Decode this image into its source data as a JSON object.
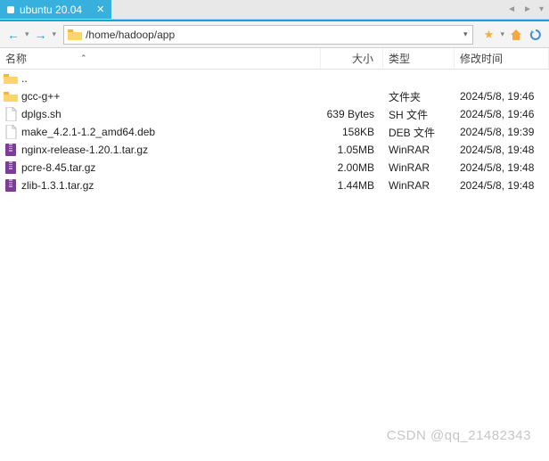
{
  "tab": {
    "title": "ubuntu 20.04"
  },
  "toolbar": {
    "path": "/home/hadoop/app"
  },
  "columns": {
    "name": "名称",
    "size": "大小",
    "type": "类型",
    "date": "修改时间"
  },
  "files": [
    {
      "icon": "folder-up",
      "name": "..",
      "size": "",
      "type": "",
      "date": ""
    },
    {
      "icon": "folder",
      "name": "gcc-g++",
      "size": "",
      "type": "文件夹",
      "date": "2024/5/8, 19:46"
    },
    {
      "icon": "sh",
      "name": "dplgs.sh",
      "size": "639 Bytes",
      "type": "SH 文件",
      "date": "2024/5/8, 19:46"
    },
    {
      "icon": "deb",
      "name": "make_4.2.1-1.2_amd64.deb",
      "size": "158KB",
      "type": "DEB 文件",
      "date": "2024/5/8, 19:39"
    },
    {
      "icon": "archive",
      "name": "nginx-release-1.20.1.tar.gz",
      "size": "1.05MB",
      "type": "WinRAR",
      "date": "2024/5/8, 19:48"
    },
    {
      "icon": "archive",
      "name": "pcre-8.45.tar.gz",
      "size": "2.00MB",
      "type": "WinRAR",
      "date": "2024/5/8, 19:48"
    },
    {
      "icon": "archive",
      "name": "zlib-1.3.1.tar.gz",
      "size": "1.44MB",
      "type": "WinRAR",
      "date": "2024/5/8, 19:48"
    }
  ],
  "watermark": "CSDN @qq_21482343"
}
